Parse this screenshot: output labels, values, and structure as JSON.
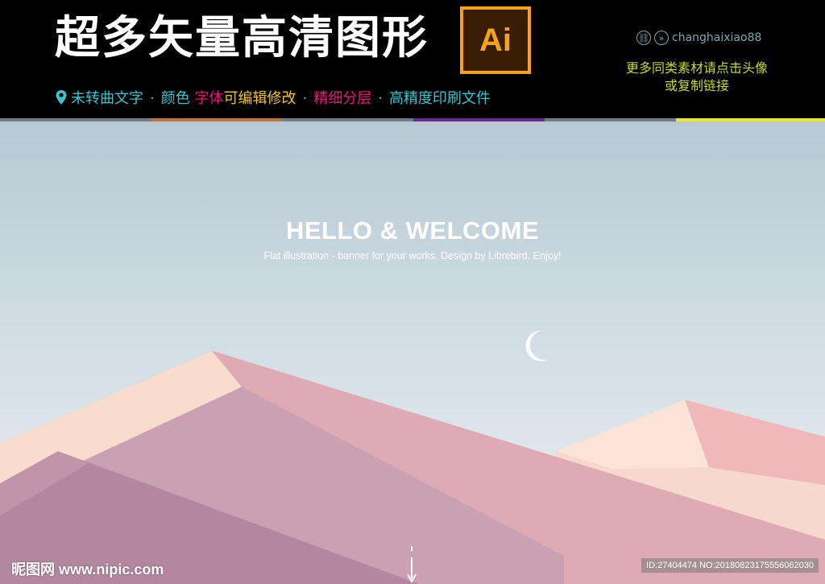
{
  "header": {
    "title": "超多矢量高清图形",
    "ai_logo_text": "Ai",
    "features": {
      "item1": "未转曲文字",
      "sep": "·",
      "item2": "颜色",
      "item3a": "字体",
      "item3b": "可编辑修改",
      "item4": "精细分层",
      "item5": "高精度印刷文件"
    },
    "author": "changhaixiao88",
    "promo_line1": "更多同类素材请点击头像",
    "promo_line2": "或复制链接"
  },
  "colors": {
    "accent_cyan": "#39c4d0",
    "accent_pink": "#f0127e",
    "accent_yellow": "#f5c12c",
    "promo_green": "#c7d630",
    "ai_orange": "#f7a21b"
  },
  "banner": {
    "headline": "HELLO & WELCOME",
    "subtitle": "Flat illustration - banner for your works. Design by Librebird. Enjoy!"
  },
  "watermark": {
    "site": "昵图网 www.nipic.com",
    "id_text": "ID:27404474 NO:20180823175556062030"
  }
}
